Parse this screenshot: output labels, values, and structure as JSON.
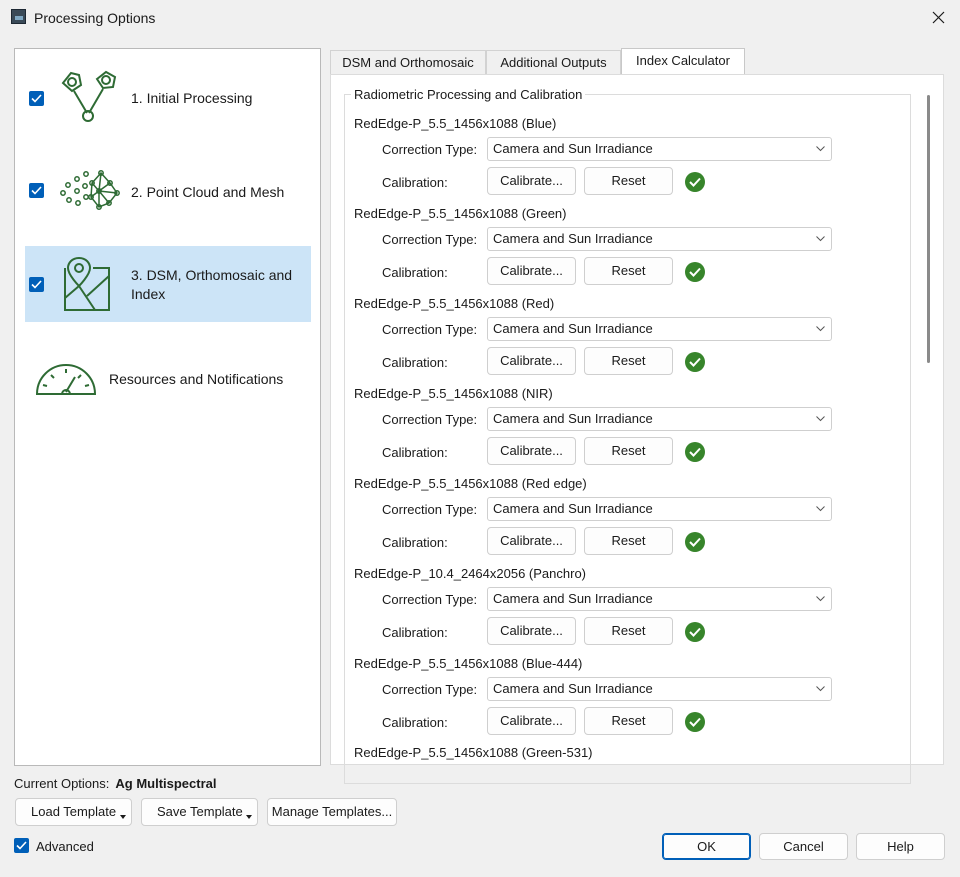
{
  "window": {
    "title": "Processing Options",
    "app_icon": "pix4d-app-icon",
    "close_icon": "close-icon"
  },
  "steps": [
    {
      "label": "1. Initial Processing",
      "checked": true,
      "icon": "initial-processing-icon"
    },
    {
      "label": "2. Point Cloud and Mesh",
      "checked": true,
      "icon": "point-cloud-icon"
    },
    {
      "label": "3. DSM, Orthomosaic and Index",
      "checked": true,
      "active": true,
      "icon": "map-pin-icon"
    },
    {
      "label": "Resources and Notifications",
      "icon": "gauge-icon"
    }
  ],
  "tabs": [
    {
      "label": "DSM and Orthomosaic"
    },
    {
      "label": "Additional Outputs"
    },
    {
      "label": "Index Calculator",
      "active": true
    }
  ],
  "group": {
    "title": "Radiometric Processing and Calibration",
    "correction_label": "Correction Type:",
    "calibration_label": "Calibration:",
    "calibrate_button": "Calibrate...",
    "reset_button": "Reset",
    "cameras": [
      {
        "name": "RedEdge-P_5.5_1456x1088 (Blue)",
        "correction": "Camera and Sun Irradiance"
      },
      {
        "name": "RedEdge-P_5.5_1456x1088 (Green)",
        "correction": "Camera and Sun Irradiance"
      },
      {
        "name": "RedEdge-P_5.5_1456x1088 (Red)",
        "correction": "Camera and Sun Irradiance"
      },
      {
        "name": "RedEdge-P_5.5_1456x1088 (NIR)",
        "correction": "Camera and Sun Irradiance"
      },
      {
        "name": "RedEdge-P_5.5_1456x1088 (Red edge)",
        "correction": "Camera and Sun Irradiance"
      },
      {
        "name": "RedEdge-P_10.4_2464x2056 (Panchro)",
        "correction": "Camera and Sun Irradiance"
      },
      {
        "name": "RedEdge-P_5.5_1456x1088 (Blue-444)",
        "correction": "Camera and Sun Irradiance"
      }
    ],
    "last_camera": "RedEdge-P_5.5_1456x1088 (Green-531)"
  },
  "bottom": {
    "current_options_label": "Current Options:",
    "current_options_value": "Ag Multispectral",
    "load_template": "Load Template",
    "save_template": "Save Template",
    "manage_templates": "Manage Templates...",
    "advanced_label": "Advanced",
    "advanced_checked": true,
    "ok": "OK",
    "cancel": "Cancel",
    "help": "Help"
  },
  "colors": {
    "accent": "#005fb8",
    "icon_green": "#2e6b34",
    "status_ok": "#37852b",
    "selection": "#cce4f7"
  }
}
